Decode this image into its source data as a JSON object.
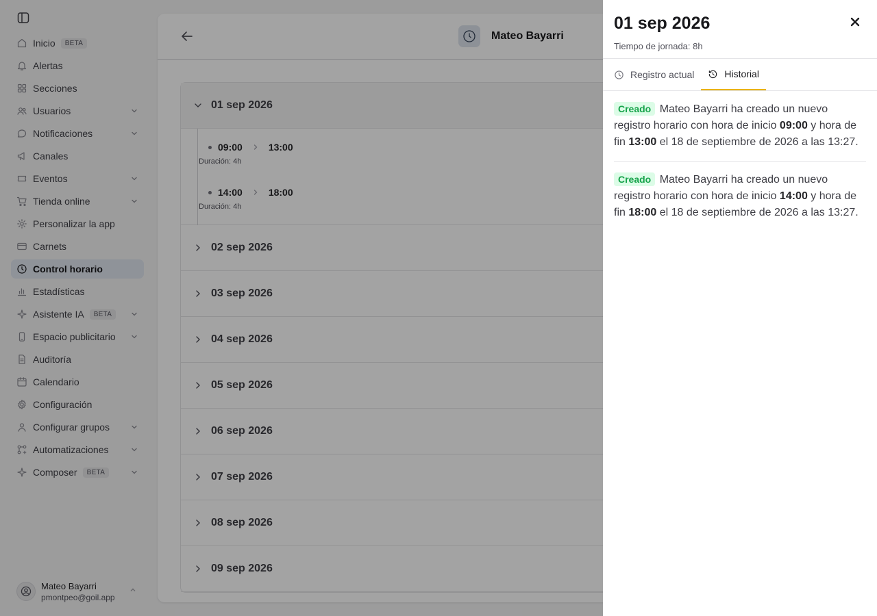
{
  "sidebar": {
    "items": [
      {
        "label": "Inicio",
        "badge": "BETA",
        "icon": "home-icon",
        "expandable": false,
        "active": false
      },
      {
        "label": "Alertas",
        "icon": "bell-icon",
        "expandable": false,
        "active": false
      },
      {
        "label": "Secciones",
        "icon": "sections-icon",
        "expandable": false,
        "active": false
      },
      {
        "label": "Usuarios",
        "icon": "users-icon",
        "expandable": true,
        "active": false
      },
      {
        "label": "Notificaciones",
        "icon": "chat-icon",
        "expandable": true,
        "active": false
      },
      {
        "label": "Canales",
        "icon": "megaphone-icon",
        "expandable": false,
        "active": false
      },
      {
        "label": "Eventos",
        "icon": "ticket-icon",
        "expandable": true,
        "active": false
      },
      {
        "label": "Tienda online",
        "icon": "cart-icon",
        "expandable": true,
        "active": false
      },
      {
        "label": "Personalizar la app",
        "icon": "settings-icon",
        "expandable": false,
        "active": false
      },
      {
        "label": "Carnets",
        "icon": "card-icon",
        "expandable": false,
        "active": false
      },
      {
        "label": "Control horario",
        "icon": "clock-icon",
        "expandable": false,
        "active": true
      },
      {
        "label": "Estadísticas",
        "icon": "chart-icon",
        "expandable": false,
        "active": false
      },
      {
        "label": "Asistente IA",
        "badge": "BETA",
        "icon": "sparkle-icon",
        "expandable": true,
        "active": false
      },
      {
        "label": "Espacio publicitario",
        "icon": "phone-icon",
        "expandable": true,
        "active": false
      },
      {
        "label": "Auditoría",
        "icon": "document-icon",
        "expandable": false,
        "active": false
      },
      {
        "label": "Calendario",
        "icon": "calendar-icon",
        "expandable": false,
        "active": false
      },
      {
        "label": "Configuración",
        "icon": "gear-icon",
        "expandable": false,
        "active": false
      },
      {
        "label": "Configurar grupos",
        "icon": "user-group-icon",
        "expandable": true,
        "active": false
      },
      {
        "label": "Automatizaciones",
        "icon": "automation-icon",
        "expandable": true,
        "active": false
      },
      {
        "label": "Composer",
        "badge": "BETA",
        "icon": "sparkle-icon",
        "expandable": true,
        "active": false
      }
    ],
    "user": {
      "name": "Mateo Bayarri",
      "email": "pmontpeo@goil.app"
    }
  },
  "main": {
    "header": {
      "name": "Mateo Bayarri"
    },
    "days": [
      {
        "label": "01 sep 2026",
        "expanded": true
      },
      {
        "label": "02 sep 2026",
        "expanded": false
      },
      {
        "label": "03 sep 2026",
        "expanded": false
      },
      {
        "label": "04 sep 2026",
        "expanded": false
      },
      {
        "label": "05 sep 2026",
        "expanded": false
      },
      {
        "label": "06 sep 2026",
        "expanded": false
      },
      {
        "label": "07 sep 2026",
        "expanded": false
      },
      {
        "label": "08 sep 2026",
        "expanded": false
      },
      {
        "label": "09 sep 2026",
        "expanded": false
      }
    ],
    "segments": [
      {
        "start": "09:00",
        "end": "13:00",
        "duration": "Duración: 4h"
      },
      {
        "start": "14:00",
        "end": "18:00",
        "duration": "Duración: 4h"
      }
    ]
  },
  "drawer": {
    "title": "01 sep 2026",
    "subtitle": "Tiempo de jornada: 8h",
    "tabs": [
      {
        "label": "Registro actual",
        "icon": "clock-icon",
        "active": false
      },
      {
        "label": "Historial",
        "icon": "history-icon",
        "active": true
      }
    ],
    "entries": [
      {
        "tag": "Creado",
        "text_before": "Mateo Bayarri ha creado un nuevo registro horario con hora de inicio",
        "start": "09:00",
        "text_middle": "y hora de fin",
        "end": "13:00",
        "text_after": "el 18 de septiembre de 2026 a las 13:27."
      },
      {
        "tag": "Creado",
        "text_before": "Mateo Bayarri ha creado un nuevo registro horario con hora de inicio",
        "start": "14:00",
        "text_middle": "y hora de fin",
        "end": "18:00",
        "text_after": "el 18 de septiembre de 2026 a las 13:27."
      }
    ]
  },
  "colors": {
    "accent": "#eab308",
    "created_bg": "#dcfce7",
    "created_text": "#16a34a",
    "active_nav": "#e0e6ef"
  }
}
